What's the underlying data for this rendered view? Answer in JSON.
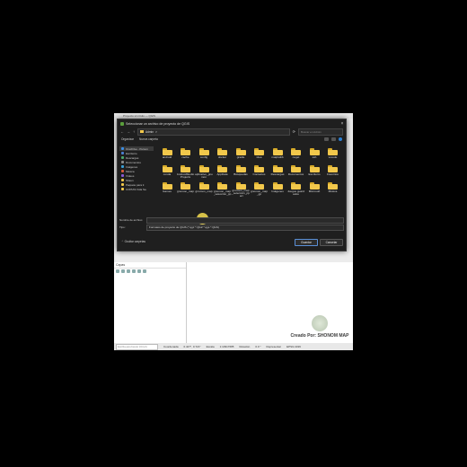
{
  "qgis": {
    "window_title": "Proyecto sin título — QGIS",
    "layers_title": "Capas",
    "locator_placeholder": "Escriba para buscar (Ctrl+K)",
    "status_coordinate": "Coordenada",
    "status_coordinate_value": "0.427°, 0.721°",
    "status_scale": "Escala",
    "status_scale_value": "1:10917685",
    "status_rotation": "Rotación",
    "status_rotation_value": "0.0 °",
    "status_render": "Representar",
    "status_crs": "EPSG:4326"
  },
  "watermark": {
    "text": "Creado Por: SHONOM MAP"
  },
  "dialog": {
    "title": "Seleccionar un archivo de proyecto de QGIS",
    "path_parts": [
      "Admin",
      ">"
    ],
    "search_placeholder": "Buscar en Admin",
    "organize": "Organizar",
    "new_folder": "Nueva carpeta",
    "nav_items": [
      {
        "label": "OneDrive - Person",
        "color": "#3a8ee6",
        "selected": true
      },
      {
        "label": "Escritorio",
        "color": "#4a7fd0",
        "selected": false
      },
      {
        "label": "Descargas",
        "color": "#4aa66a",
        "selected": false
      },
      {
        "label": "Documentos",
        "color": "#8a8a8a",
        "selected": false
      },
      {
        "label": "Imágenes",
        "color": "#3aa0d6",
        "selected": false
      },
      {
        "label": "Música",
        "color": "#d65a3a",
        "selected": false
      },
      {
        "label": "Vídeos",
        "color": "#8a5ad6",
        "selected": false
      },
      {
        "label": "Shaun",
        "color": "#f2c84b",
        "selected": false
      },
      {
        "label": "Paquete para ti",
        "color": "#f2c84b",
        "selected": false
      },
      {
        "label": "COPIAS Vida Sa",
        "color": "#f2c84b",
        "selected": false
      }
    ],
    "folders": [
      "android",
      "cache",
      "config",
      "docker",
      "gradle",
      "idea",
      "matplotlib",
      "nuget",
      "ssh",
      "vscode",
      "conda",
      "AndroidStudioProjects",
      "aplicativo_gnomon",
      "AppData",
      "Búsquedas",
      "Contactos",
      "Descargas",
      "Documentos",
      "Escritorio",
      "Favoritos",
      "Games",
      "gnomon_map",
      "gnomon_map",
      "gnomon_map_selección_pp",
      "gnomon_map_selección_pp_arr",
      "gnomon_map_gp",
      "Imágenes",
      "Juegos guardados",
      "Microsoft",
      "Música"
    ],
    "filename_label": "Nombre de archivo:",
    "filename_value": "",
    "type_label": "Tipo:",
    "type_value": "Formatos de proyecto de QGIS (*.qgz *.QGZ *.qgs *.QGS)",
    "hide_folders": "Ocultar carpetas",
    "open_button": "Guardar",
    "cancel_button": "Cancelar"
  }
}
